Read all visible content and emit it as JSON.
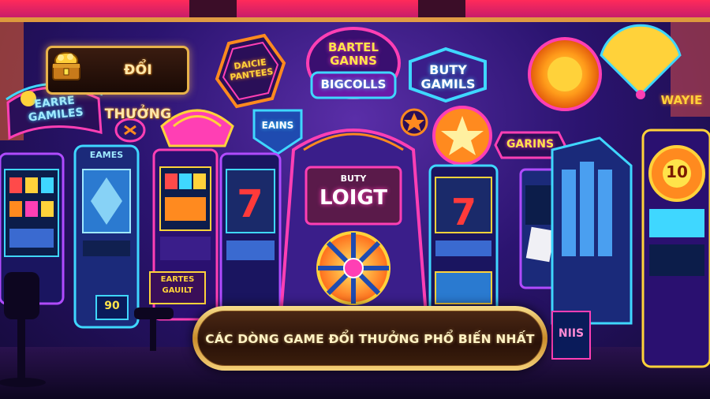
{
  "badge": {
    "label": "ĐỔI THƯỞNG",
    "icon": "treasure-chest-icon"
  },
  "banner": {
    "title": "CÁC DÒNG GAME ĐỔI THƯỞNG PHỔ BIẾN NHẤT"
  },
  "neon_signs": {
    "sign_1": "EARRE GAMILES",
    "sign_2": "DAICIE PANTEES",
    "sign_3": "BARTEL GANNS",
    "sign_4": "BIGCOLLS",
    "sign_5": "BUTY GAMILS",
    "sign_6": "EAINS",
    "sign_7": "GARINS",
    "sign_8": "WAYIE",
    "center_1": "BUTY",
    "center_2": "LOIGT",
    "cabinet_1": "EARTES",
    "cabinet_2": "GAUILT",
    "cabinet_3": "90",
    "cabinet_4": "NIIS",
    "machine_tag_1": "EAMES",
    "machine_tag_2": "10"
  },
  "colors": {
    "accent_gold": "#e7b24a",
    "neon_pink": "#ff3fb4",
    "neon_blue": "#3fd7ff",
    "neon_orange": "#ff8a1f",
    "neon_purple": "#b04bff"
  }
}
